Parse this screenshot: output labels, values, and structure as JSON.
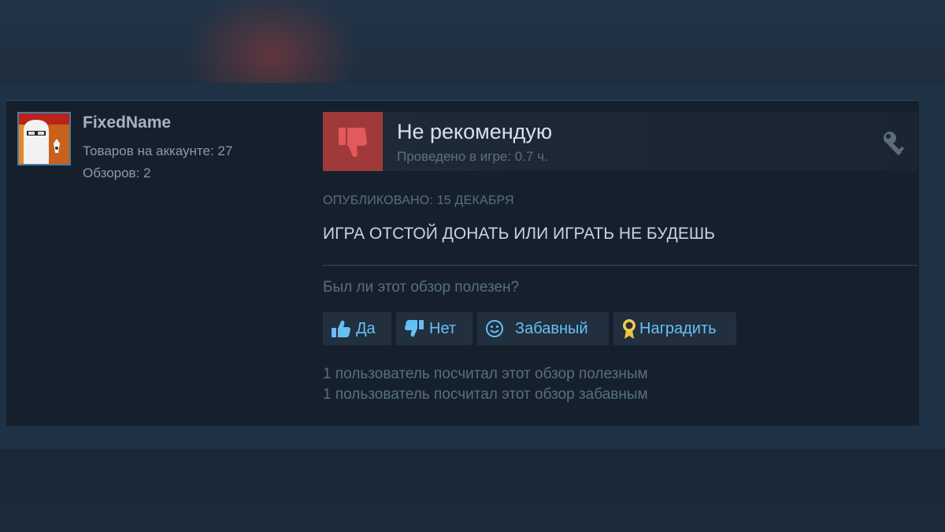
{
  "author": {
    "name": "FixedName",
    "games_owned": "Товаров на аккаунте: 27",
    "reviews_count": "Обзоров: 2",
    "avatar_icon": "avatar-image"
  },
  "review": {
    "verdict": "Не рекомендую",
    "verdict_icon": "thumbs-down-icon",
    "hours": "Проведено в игре: 0.7 ч.",
    "key_icon": "key-icon",
    "posted": "ОПУБЛИКОВАНО: 15 ДЕКАБРЯ",
    "text": "ИГРА ОТСТОЙ ДОНАТЬ ИЛИ ИГРАТЬ НЕ БУДЕШЬ"
  },
  "helpful": {
    "question": "Был ли этот обзор полезен?",
    "buttons": {
      "yes": "Да",
      "no": "Нет",
      "funny": "Забавный",
      "award": "Наградить"
    },
    "found_helpful": "1 пользователь посчитал этот обзор полезным",
    "found_funny": "1 пользователь посчитал этот обзор забавным"
  },
  "colors": {
    "background": "#1b2838",
    "card": "#16202d",
    "accent_link": "#66c0f4",
    "not_recommended": "#a03a3a"
  }
}
